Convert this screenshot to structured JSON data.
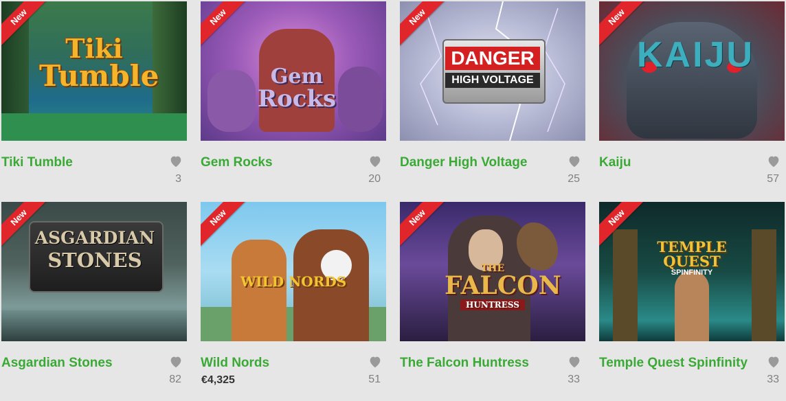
{
  "games": [
    {
      "title": "Tiki Tumble",
      "badge": "New",
      "count": "3",
      "logo": [
        "Tiki",
        "Tumble"
      ],
      "icon": "heart-icon"
    },
    {
      "title": "Gem Rocks",
      "badge": "New",
      "count": "20",
      "logo": [
        "Gem",
        "Rocks"
      ],
      "icon": "heart-icon"
    },
    {
      "title": "Danger High Voltage",
      "badge": "New",
      "count": "25",
      "logo": [
        "DANGER",
        "HIGH VOLTAGE"
      ],
      "icon": "heart-icon"
    },
    {
      "title": "Kaiju",
      "badge": "New",
      "count": "57",
      "logo": [
        "KAIJU"
      ],
      "icon": "heart-icon"
    },
    {
      "title": "Asgardian Stones",
      "badge": "New",
      "count": "82",
      "logo": [
        "ASGARDIAN",
        "STONES"
      ],
      "icon": "heart-icon"
    },
    {
      "title": "Wild Nords",
      "badge": "New",
      "count": "51",
      "jackpot": "€4,325",
      "logo": [
        "WILD NORDS"
      ],
      "icon": "heart-icon"
    },
    {
      "title": "The Falcon Huntress",
      "badge": "New",
      "count": "33",
      "logo": [
        "THE",
        "FALCON",
        "HUNTRESS"
      ],
      "icon": "heart-icon"
    },
    {
      "title": "Temple Quest Spinfinity",
      "badge": "New",
      "count": "33",
      "logo": [
        "TEMPLE QUEST",
        "SPINFINITY"
      ],
      "icon": "heart-icon"
    }
  ],
  "colors": {
    "title_green": "#3aa935",
    "ribbon_red": "#e0262b",
    "heart_grey": "#9a9a9a",
    "count_grey": "#808080"
  }
}
